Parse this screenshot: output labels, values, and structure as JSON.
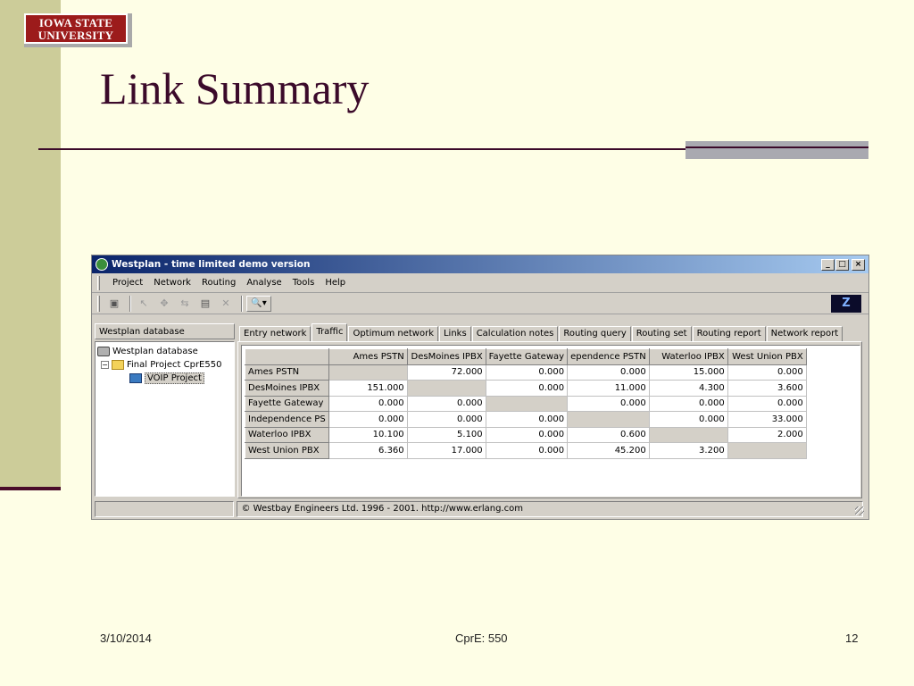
{
  "slide": {
    "logo_line1": "IOWA STATE",
    "logo_line2": "UNIVERSITY",
    "title": "Link Summary",
    "footer_date": "3/10/2014",
    "footer_course": "CprE: 550",
    "footer_page": "12"
  },
  "window": {
    "title": "Westplan - time limited demo version",
    "btn_minimize": "_",
    "btn_maximize": "□",
    "btn_close": "×"
  },
  "menu": [
    "Project",
    "Network",
    "Routing",
    "Analyse",
    "Tools",
    "Help"
  ],
  "toolbar": {
    "icons": [
      "properties-icon",
      "pointer-icon",
      "add-node-icon",
      "add-link-icon",
      "calculator-icon",
      "delete-icon",
      "print-preview-icon"
    ],
    "corner_logo": "Z"
  },
  "left_pane": {
    "header": "Westplan database",
    "tree": [
      {
        "label": "Westplan database",
        "icon": "database-icon",
        "level": 0
      },
      {
        "label": "Final Project CprE550",
        "icon": "folder-icon",
        "level": 1
      },
      {
        "label": "VOIP Project",
        "icon": "project-icon",
        "level": 2,
        "selected": true
      }
    ]
  },
  "tabs": [
    "Entry network",
    "Traffic",
    "Optimum network",
    "Links",
    "Calculation notes",
    "Routing query",
    "Routing set",
    "Routing report",
    "Network report"
  ],
  "active_tab": "Traffic",
  "traffic_table": {
    "columns": [
      "Ames PSTN",
      "DesMoines IPBX",
      "Fayette Gateway",
      "ependence PSTN",
      "Waterloo IPBX",
      "West Union PBX"
    ],
    "rows": [
      {
        "name": "Ames PSTN",
        "values": [
          "",
          "72.000",
          "0.000",
          "0.000",
          "15.000",
          "0.000"
        ]
      },
      {
        "name": "DesMoines IPBX",
        "values": [
          "151.000",
          "",
          "0.000",
          "11.000",
          "4.300",
          "3.600"
        ]
      },
      {
        "name": "Fayette Gateway",
        "values": [
          "0.000",
          "0.000",
          "",
          "0.000",
          "0.000",
          "0.000"
        ]
      },
      {
        "name": "Independence PS",
        "values": [
          "0.000",
          "0.000",
          "0.000",
          "",
          "0.000",
          "33.000"
        ]
      },
      {
        "name": "Waterloo IPBX",
        "values": [
          "10.100",
          "5.100",
          "0.000",
          "0.600",
          "",
          "2.000"
        ]
      },
      {
        "name": "West Union PBX",
        "values": [
          "6.360",
          "17.000",
          "0.000",
          "45.200",
          "3.200",
          ""
        ]
      }
    ]
  },
  "statusbar": {
    "left": "",
    "right": "© Westbay Engineers Ltd. 1996 - 2001.  http://www.erlang.com"
  }
}
